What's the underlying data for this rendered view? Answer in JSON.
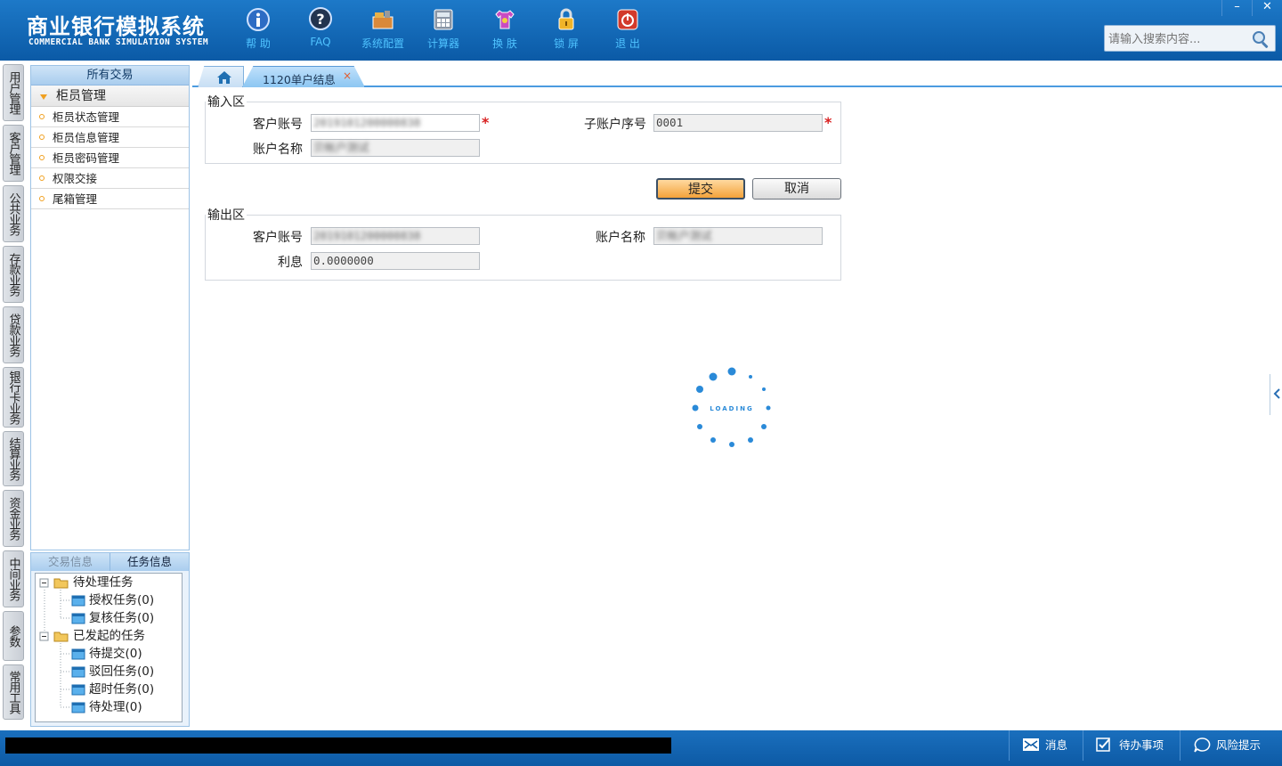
{
  "app": {
    "title_cn": "商业银行模拟系统",
    "title_en": "COMMERCIAL BANK SIMULATION SYSTEM"
  },
  "toolbar": [
    {
      "label": "帮 助",
      "icon": "info-icon"
    },
    {
      "label": "FAQ",
      "icon": "help-icon"
    },
    {
      "label": "系统配置",
      "icon": "toolbox-icon"
    },
    {
      "label": "计算器",
      "icon": "calculator-icon"
    },
    {
      "label": "换 肤",
      "icon": "shirt-icon"
    },
    {
      "label": "锁 屏",
      "icon": "lock-icon"
    },
    {
      "label": "退 出",
      "icon": "power-icon"
    }
  ],
  "window_controls": {
    "minimize": "–",
    "close": "✕"
  },
  "search": {
    "placeholder": "请输入搜索内容..."
  },
  "vertical_tabs": [
    "用户管理",
    "客户管理",
    "公共业务",
    "存款业务",
    "贷款业务",
    "银行卡业务",
    "结算业务",
    "资金业务",
    "中间业务",
    "参数",
    "常用工具"
  ],
  "menu": {
    "header": "所有交易",
    "group": "柜员管理",
    "items": [
      "柜员状态管理",
      "柜员信息管理",
      "柜员密码管理",
      "权限交接",
      "尾箱管理"
    ]
  },
  "task_panel": {
    "tab_trade": "交易信息",
    "tab_task": "任务信息",
    "tree": [
      {
        "label": "待处理任务",
        "level": 0,
        "type": "folder"
      },
      {
        "label": "授权任务(0)",
        "level": 1,
        "type": "item"
      },
      {
        "label": "复核任务(0)",
        "level": 1,
        "type": "item"
      },
      {
        "label": "已发起的任务",
        "level": 0,
        "type": "folder"
      },
      {
        "label": "待提交(0)",
        "level": 1,
        "type": "item"
      },
      {
        "label": "驳回任务(0)",
        "level": 1,
        "type": "item"
      },
      {
        "label": "超时任务(0)",
        "level": 1,
        "type": "item"
      },
      {
        "label": "待处理(0)",
        "level": 1,
        "type": "item"
      }
    ]
  },
  "tabs": {
    "home_icon": "home-icon",
    "active": "1120单户结息",
    "close": "×"
  },
  "input_area": {
    "legend": "输入区",
    "customer_account_label": "客户账号",
    "customer_account_value": "2019101200000838",
    "sub_account_label": "子账户序号",
    "sub_account_value": "0001",
    "account_name_label": "账户名称",
    "account_name_value": "贝帐户测试"
  },
  "buttons": {
    "submit": "提交",
    "cancel": "取消"
  },
  "output_area": {
    "legend": "输出区",
    "customer_account_label": "客户账号",
    "customer_account_value": "2019101200000838",
    "account_name_label": "账户名称",
    "account_name_value": "贝帐户测试",
    "interest_label": "利息",
    "interest_value": "0.0000000"
  },
  "loading": {
    "text": "LOADING"
  },
  "statusbar": {
    "messages": "消息",
    "todo": "待办事项",
    "risk": "风险提示"
  },
  "colors": {
    "header": "#0b5aa6",
    "accent": "#4b9be0",
    "loading": "#2a8ad8",
    "required": "#d81e1e"
  }
}
